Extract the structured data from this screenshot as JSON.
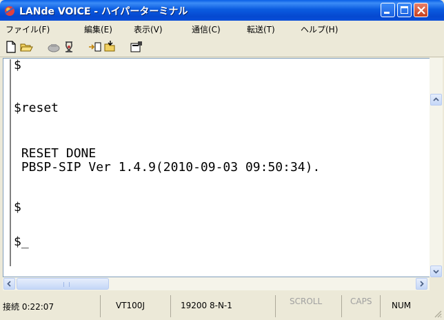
{
  "window": {
    "title": "LANde VOICE - ハイパーターミナル"
  },
  "menu": {
    "items": [
      "ファイル(F)",
      "編集(E)",
      "表示(V)",
      "通信(C)",
      "転送(T)",
      "ヘルプ(H)"
    ]
  },
  "toolbar": {
    "icons": [
      "new-icon",
      "open-icon",
      "connect-icon",
      "disconnect-icon",
      "send-icon",
      "receive-icon",
      "properties-icon"
    ]
  },
  "terminal": {
    "lines": [
      "$",
      "$reset",
      " RESET DONE",
      " PBSP-SIP Ver 1.4.9(2010-09-03 09:50:34).",
      "$",
      "$_"
    ]
  },
  "status": {
    "connected": "接続 0:22:07",
    "emulation": "VT100J",
    "port": "19200 8-N-1",
    "scroll": "SCROLL",
    "caps": "CAPS",
    "num": "NUM"
  }
}
